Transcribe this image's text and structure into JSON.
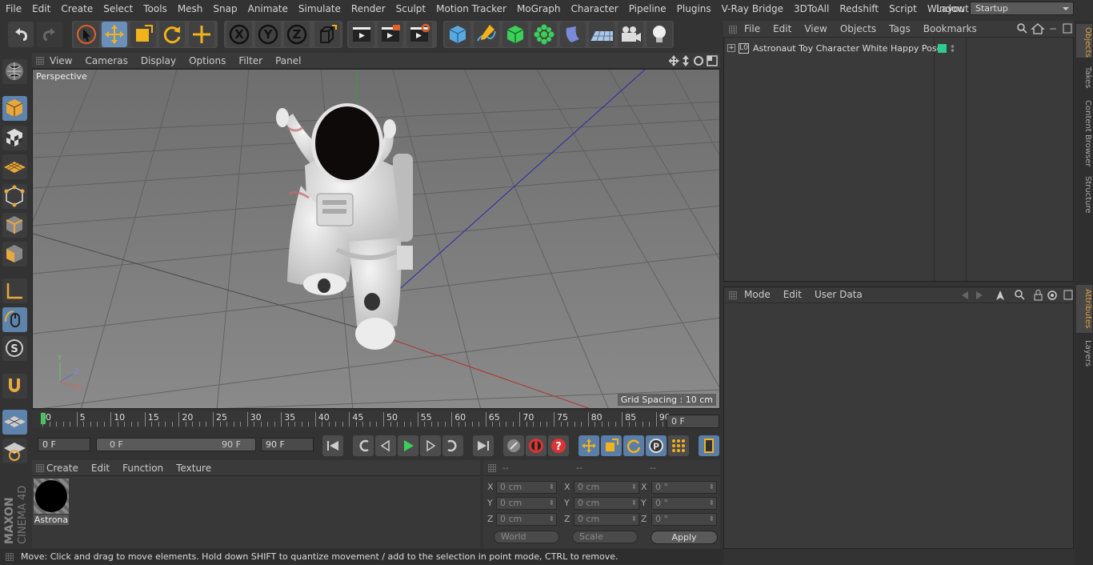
{
  "menu": [
    "File",
    "Edit",
    "Create",
    "Select",
    "Tools",
    "Mesh",
    "Snap",
    "Animate",
    "Simulate",
    "Render",
    "Sculpt",
    "Motion Tracker",
    "MoGraph",
    "Character",
    "Pipeline",
    "Plugins",
    "V-Ray Bridge",
    "3DToAll",
    "Redshift",
    "Script",
    "Window",
    "Help"
  ],
  "layout": {
    "label": "Layout:",
    "value": "Startup"
  },
  "viewport": {
    "menu": [
      "View",
      "Cameras",
      "Display",
      "Options",
      "Filter",
      "Panel"
    ],
    "camera": "Perspective",
    "grid_spacing": "Grid Spacing : 10 cm"
  },
  "timeline": {
    "ticks": [
      "0",
      "5",
      "10",
      "15",
      "20",
      "25",
      "30",
      "35",
      "40",
      "45",
      "50",
      "55",
      "60",
      "65",
      "70",
      "75",
      "80",
      "85",
      "90"
    ],
    "current_frame": "0 F",
    "start_field": "0 F",
    "range_start": "0 F",
    "range_end": "90 F",
    "end_field": "90 F"
  },
  "material_panel": {
    "menu": [
      "Create",
      "Edit",
      "Function",
      "Texture"
    ],
    "material_name": "Astrona"
  },
  "coord_panel": {
    "headers": [
      "--",
      "--",
      "--"
    ],
    "rows": [
      {
        "axis": "X",
        "pos": "0 cm",
        "axis2": "X",
        "size": "0 cm",
        "axis3": "X",
        "rot": "0 °"
      },
      {
        "axis": "Y",
        "pos": "0 cm",
        "axis2": "Y",
        "size": "0 cm",
        "axis3": "Y",
        "rot": "0 °"
      },
      {
        "axis": "Z",
        "pos": "0 cm",
        "axis2": "Z",
        "size": "0 cm",
        "axis3": "Z",
        "rot": "0 °"
      }
    ],
    "mode_select": "World",
    "type_select": "Scale",
    "apply_label": "Apply"
  },
  "objects_panel": {
    "menu": [
      "File",
      "Edit",
      "View",
      "Objects",
      "Tags",
      "Bookmarks"
    ],
    "object_name": "Astronaut Toy Character White Happy Pose"
  },
  "attributes_panel": {
    "menu": [
      "Mode",
      "Edit",
      "User Data"
    ]
  },
  "right_tabs": [
    "Objects",
    "Takes",
    "Content Browser",
    "Structure",
    "Attributes",
    "Layers"
  ],
  "status": "Move: Click and drag to move elements. Hold down SHIFT to quantize movement / add to the selection in point mode, CTRL to remove.",
  "brand": {
    "line1": "MAXON",
    "line2": "CINEMA 4D"
  },
  "colors": {
    "accent": "#6a8fb8",
    "object_tag": "#2ecc8a",
    "play": "#3ccf5a"
  }
}
